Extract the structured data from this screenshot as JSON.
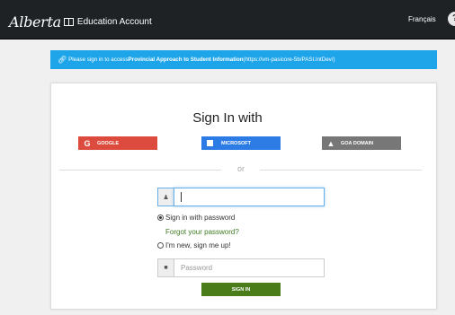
{
  "header": {
    "logo_script": "Alberta",
    "app_name": "Education Account",
    "language_link": "Français",
    "help_icon": "?"
  },
  "banner": {
    "icon": "link-icon",
    "prefix": "Please sign in to access ",
    "app_bold": "Provincial Approach to Student Information",
    "url": " (https://vm-pasicore-5b/PASI.IntDev/)"
  },
  "card": {
    "title": "Sign In with",
    "sso": {
      "google": "GOOGLE",
      "microsoft": "MICROSOFT",
      "goa": "GOA DOMAIN"
    },
    "divider_text": "or",
    "username": {
      "value": "",
      "placeholder": ""
    },
    "radio_password": "Sign in with password",
    "forgot_link": "Forgot your password?",
    "radio_new": "I'm new, sign me up!",
    "password": {
      "value": "",
      "placeholder": "Password"
    },
    "signin_button": "SIGN IN"
  },
  "colors": {
    "header_bg": "#1e2225",
    "banner_bg": "#1ea5e9",
    "google": "#dc4b3d",
    "microsoft": "#2d7be5",
    "goa": "#777777",
    "signin": "#4a7c1a",
    "link": "#3e7b22"
  }
}
